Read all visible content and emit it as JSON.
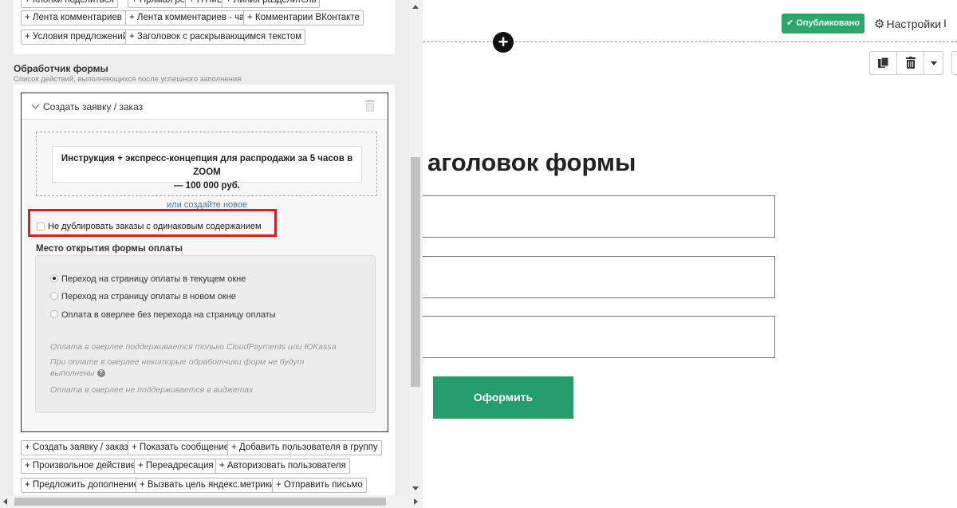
{
  "top_chips": {
    "row0": [
      "+ Кнопки поделиться",
      "+ Прямая речь",
      "+ HTML",
      "+ Линия разделитель"
    ],
    "row1": [
      "+ Лента комментариев",
      "+ Лента комментариев - чат",
      "+ Комментарии ВКонтакте"
    ],
    "row2": [
      "+ Условия предложений",
      "+ Заголовок с раскрывающимся текстом"
    ]
  },
  "form_handler": {
    "title": "Обработчик формы",
    "subtitle": "Список действий, выполняющихся после успешного заполнения",
    "action_title": "Создать заявку / заказ",
    "product_line1": "Инструкция + экспресс-концепция для распродажи за 5 часов в ZOOM",
    "product_line2": "— 100 000 руб.",
    "create_new_link": "или создайте новое",
    "no_duplicate_label": "Не дублировать заказы с одинаковым содержанием",
    "payment_place_title": "Место открытия формы оплаты",
    "payment_options": [
      "Переход на страницу оплаты в текущем окне",
      "Переход на страницу оплаты в новом окне",
      "Оплата в оверлее без перехода на страницу оплаты"
    ],
    "payment_selected_index": 0,
    "notes": [
      "Оплата в оверлее поддерживается только CloudPayments или ЮKassa",
      "При оплате в оверлее некоторые обработчики форм не будут",
      "выполнены",
      "Оплата в оверлее не поддерживается в виджетах"
    ],
    "help_glyph": "?"
  },
  "bottom_chips": {
    "row0": [
      "+ Создать заявку / заказ",
      "+ Показать сообщение",
      "+ Добавить пользователя в группу"
    ],
    "row1": [
      "+ Произвольное действие",
      "+ Переадресация",
      "+ Авторизовать пользователя"
    ],
    "row2": [
      "+ Предложить дополнение",
      "+ Вызвать цель яндекс.метрики",
      "+ Отправить письмо"
    ]
  },
  "toolbar": {
    "published_label": "Опубликовано",
    "settings_label": "Настройки",
    "settings_suffix": "I",
    "add_glyph": "+"
  },
  "form_preview": {
    "heading": "аголовок формы",
    "submit_label": "Оформить"
  },
  "colors": {
    "accent_green": "#2ca66a",
    "submit_green": "#239e6b",
    "highlight_red": "#e0191b",
    "link_blue": "#4a76a8"
  },
  "icons": {
    "chevron": "chevron-down-icon",
    "trash": "trash-icon",
    "copy": "copy-icon",
    "check": "check-icon",
    "gear": "gear-icon",
    "caret": "caret-down-icon",
    "plus": "plus-circle-icon"
  }
}
